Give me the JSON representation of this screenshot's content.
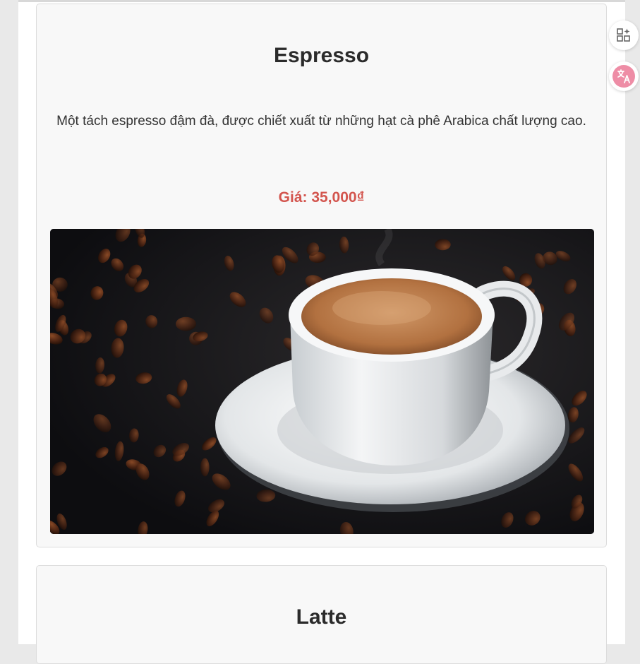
{
  "products": [
    {
      "name": "Espresso",
      "description": "Một tách espresso đậm đà, được chiết xuất từ những hạt cà phê Arabica chất lượng cao.",
      "price": "Giá: 35,000₫",
      "image": "espresso-cup-with-coffee-beans"
    },
    {
      "name": "Latte"
    }
  ],
  "colors": {
    "price": "#d3554e",
    "card_background": "#f8f8f8",
    "translate_accent": "#ee8da6"
  },
  "side_toolbar": {
    "apps_icon": "apps-sparkle-icon",
    "translate_icon": "translate-icon"
  }
}
